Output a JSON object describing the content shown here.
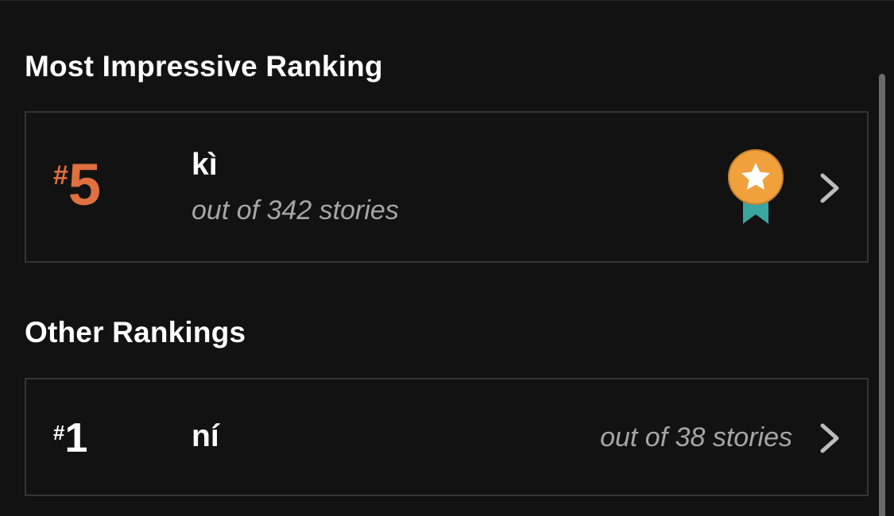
{
  "sections": {
    "most_impressive_title": "Most Impressive Ranking",
    "other_title": "Other Rankings"
  },
  "top_ranking": {
    "hash": "#",
    "rank": "5",
    "tag": "kì",
    "out_of": "out of 342 stories",
    "badge_icon": "award-ribbon-star-icon",
    "rank_color": "#e0703f",
    "badge_color": "#f0a13c",
    "ribbon_color": "#3aa6a0"
  },
  "other_rankings": [
    {
      "hash": "#",
      "rank": "1",
      "tag": "ní",
      "out_of": "out of 38 stories"
    }
  ],
  "colors": {
    "background": "#121212",
    "card_border": "#363636",
    "muted_text": "#a6a6a6",
    "chevron": "#bdbdbd",
    "scrollbar": "#6b6b6b"
  }
}
